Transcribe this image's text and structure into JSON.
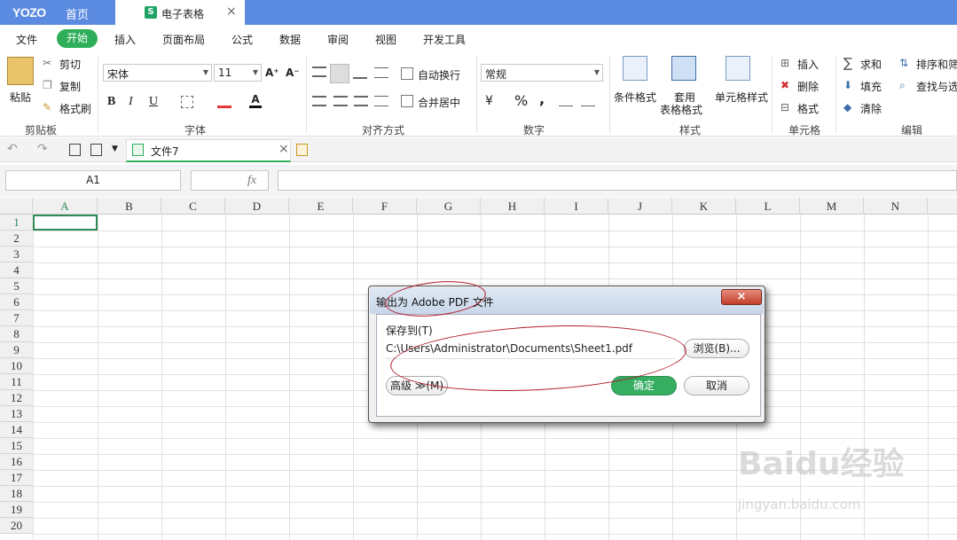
{
  "titlebar": {
    "brand": "YOZO",
    "home": "首页",
    "tab_title": "电子表格",
    "tab_icon": "S",
    "close": "×"
  },
  "menu": {
    "items": [
      "文件",
      "开始",
      "插入",
      "页面布局",
      "公式",
      "数据",
      "审阅",
      "视图",
      "开发工具"
    ]
  },
  "ribbon": {
    "clipboard": {
      "paste": "粘贴",
      "cut": "剪切",
      "copy": "复制",
      "format_painter": "格式刷",
      "group": "剪贴板"
    },
    "font": {
      "name": "宋体",
      "size": "11",
      "bold": "B",
      "italic": "I",
      "underline": "U",
      "grow": "A⁺",
      "shrink": "A⁻",
      "group": "字体"
    },
    "align": {
      "wrap": "自动换行",
      "merge": "合并居中",
      "group": "对齐方式"
    },
    "number": {
      "format": "常规",
      "currency": "¥",
      "percent": "%",
      "comma": ",",
      "group": "数字"
    },
    "styles": {
      "cond": "条件格式",
      "table": "套用",
      "table2": "表格格式",
      "cell_style": "单元格样式",
      "group": "样式"
    },
    "cells": {
      "insert": "插入",
      "delete": "删除",
      "format": "格式",
      "group": "单元格"
    },
    "editing": {
      "sum": "求和",
      "fill": "填充",
      "clear": "清除",
      "sort": "排序和筛",
      "find": "查找与选",
      "group": "编辑"
    }
  },
  "qat": {
    "doc_tab": "文件7"
  },
  "formula": {
    "namebox": "A1",
    "fx": "fx"
  },
  "grid": {
    "columns": [
      "A",
      "B",
      "C",
      "D",
      "E",
      "F",
      "G",
      "H",
      "I",
      "J",
      "K",
      "L",
      "M",
      "N"
    ],
    "rows": [
      "1",
      "2",
      "3",
      "4",
      "5",
      "6",
      "7",
      "8",
      "9",
      "10",
      "11",
      "12",
      "13",
      "14",
      "15",
      "16",
      "17",
      "18",
      "19",
      "20"
    ]
  },
  "dialog": {
    "title": "输出为 Adobe PDF 文件",
    "save_to_label": "保存到(T)",
    "path": "C:\\Users\\Administrator\\Documents\\Sheet1.pdf",
    "browse": "浏览(B)...",
    "advanced": "高级 ≫(M)",
    "ok": "确定",
    "cancel": "取消",
    "close": "×"
  },
  "watermark": {
    "brand": "Baidu经验",
    "url": "jingyan.baidu.com"
  },
  "colors": {
    "titlebar": "#5b8be0",
    "accent": "#2eae59",
    "annotation": "#b01a2c"
  }
}
